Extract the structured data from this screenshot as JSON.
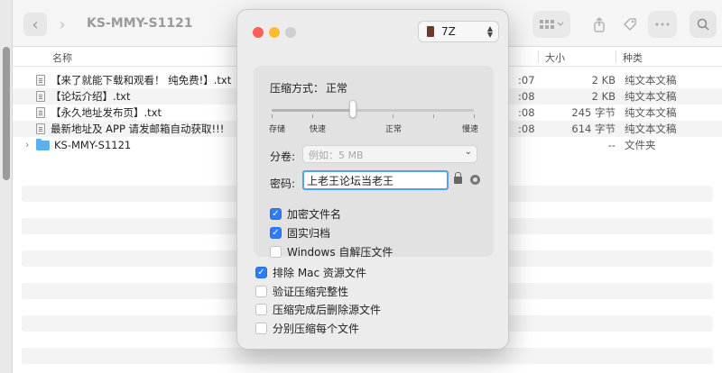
{
  "finder": {
    "title": "KS-MMY-S1121",
    "nav_back": "‹",
    "nav_forward": "›",
    "columns": {
      "name": "名称",
      "size": "大小",
      "kind": "种类"
    },
    "files": [
      {
        "name": "【来了就能下载和观看！ 纯免费!】.txt",
        "date": ":07",
        "size": "2 KB",
        "kind": "纯文本文稿"
      },
      {
        "name": "【论坛介绍】.txt",
        "date": ":08",
        "size": "2 KB",
        "kind": "纯文本文稿"
      },
      {
        "name": "【永久地址发布页】.txt",
        "date": ":08",
        "size": "245 字节",
        "kind": "纯文本文稿"
      },
      {
        "name": "最新地址及 APP 请发邮箱自动获取!!!",
        "date": ":08",
        "size": "614 字节",
        "kind": "纯文本文稿"
      }
    ],
    "folder": {
      "name": "KS-MMY-S1121",
      "size": "--",
      "kind": "文件夹"
    }
  },
  "dialog": {
    "format": "7Z",
    "compression_label": "压缩方式：",
    "compression_value": "正常",
    "levels": [
      "存储",
      "快速",
      "正常",
      "慢速"
    ],
    "level_index": 2,
    "level_count": 6,
    "volume_label": "分卷:",
    "volume_placeholder": "例如：5 MB",
    "password_label": "密码:",
    "password_value": "上老王论坛当老王",
    "options": [
      {
        "label": "加密文件名",
        "checked": true
      },
      {
        "label": "固实归档",
        "checked": true
      },
      {
        "label": "Windows 自解压文件",
        "checked": false
      }
    ],
    "extra_options": [
      {
        "label": "排除 Mac 资源文件",
        "checked": true
      },
      {
        "label": "验证压缩完整性",
        "checked": false
      },
      {
        "label": "压缩完成后删除源文件",
        "checked": false
      },
      {
        "label": "分别压缩每个文件",
        "checked": false
      }
    ]
  }
}
